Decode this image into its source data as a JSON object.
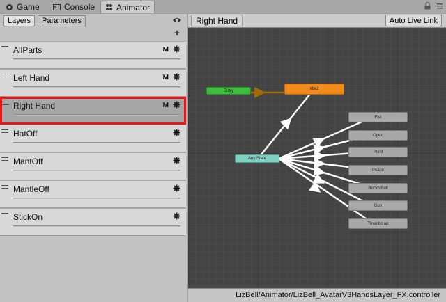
{
  "tabs": [
    {
      "label": "Game",
      "icon": "game-controller-icon"
    },
    {
      "label": "Console",
      "icon": "console-icon"
    },
    {
      "label": "Animator",
      "icon": "animator-icon"
    }
  ],
  "left_panel": {
    "tab_layers": "Layers",
    "tab_parameters": "Parameters",
    "layers": [
      {
        "name": "AllParts",
        "flag": "M"
      },
      {
        "name": "Left Hand",
        "flag": "M"
      },
      {
        "name": "Right Hand",
        "flag": "M",
        "selected": true
      },
      {
        "name": "HatOff",
        "flag": ""
      },
      {
        "name": "MantOff",
        "flag": ""
      },
      {
        "name": "MantleOff",
        "flag": ""
      },
      {
        "name": "StickOn",
        "flag": ""
      }
    ]
  },
  "graph": {
    "breadcrumb": "Right Hand",
    "auto_live_link": "Auto Live Link",
    "controller_path": "LizBell/Animator/LizBell_AvatarV3HandsLayer_FX.controller",
    "entry_label": "Entry",
    "default_state_label": "Idle2",
    "any_state_label": "Any State",
    "states": [
      "Fist",
      "Open",
      "Point",
      "Peace",
      "RockNRoll",
      "Gun",
      "Thumbs up"
    ]
  },
  "colors": {
    "entry": "#3fbf3f",
    "default_state": "#f08a1a",
    "any_state": "#7ed0c0",
    "state": "#a8a8a8",
    "selection": "#e31b1b",
    "transition": "#ffffff",
    "entry_transition": "#a36a00"
  }
}
